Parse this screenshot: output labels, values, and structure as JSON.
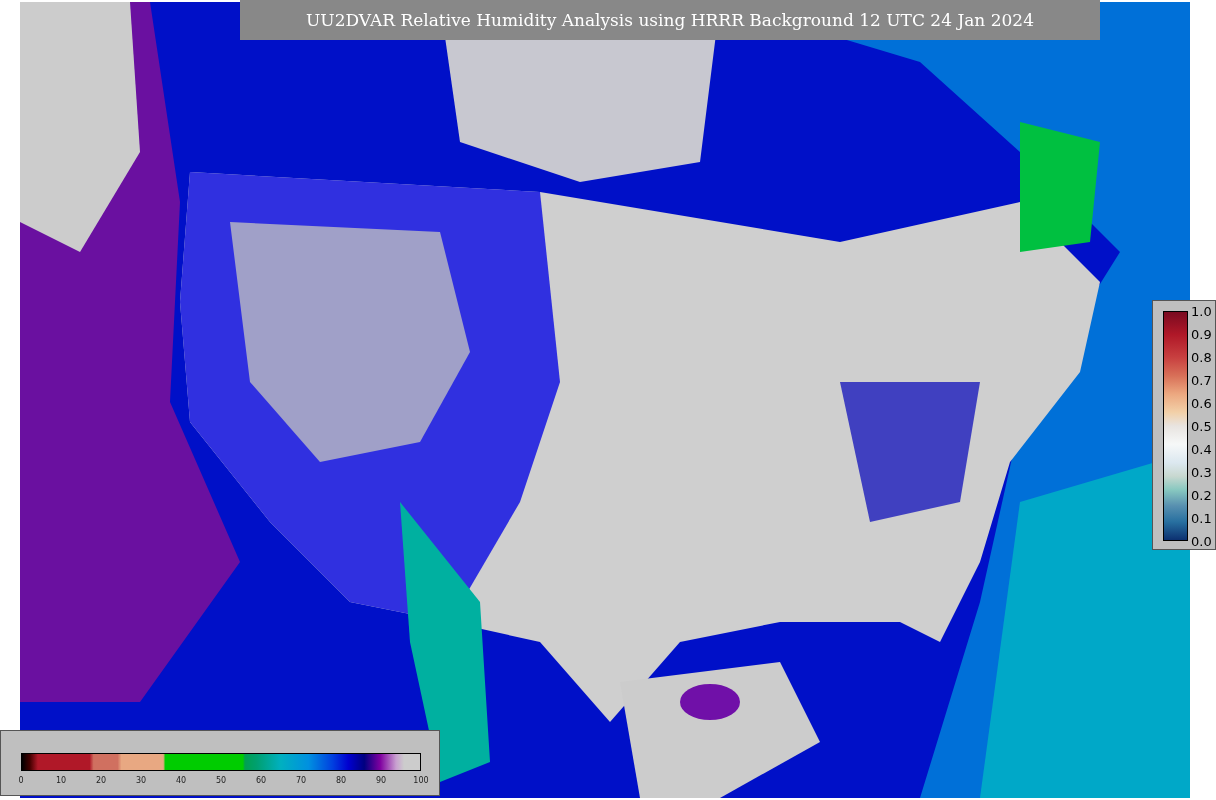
{
  "title": "UU2DVAR Relative Humidity Analysis using HRRR Background 12 UTC 24 Jan 2024",
  "humidity_colorbar": {
    "ticks": [
      "0",
      "10",
      "20",
      "30",
      "40",
      "50",
      "60",
      "70",
      "80",
      "90",
      "100"
    ]
  },
  "observation_colorbar": {
    "ticks": [
      "1.0",
      "0.9",
      "0.8",
      "0.7",
      "0.6",
      "0.5",
      "0.4",
      "0.3",
      "0.2",
      "0.1",
      "0.0"
    ]
  }
}
